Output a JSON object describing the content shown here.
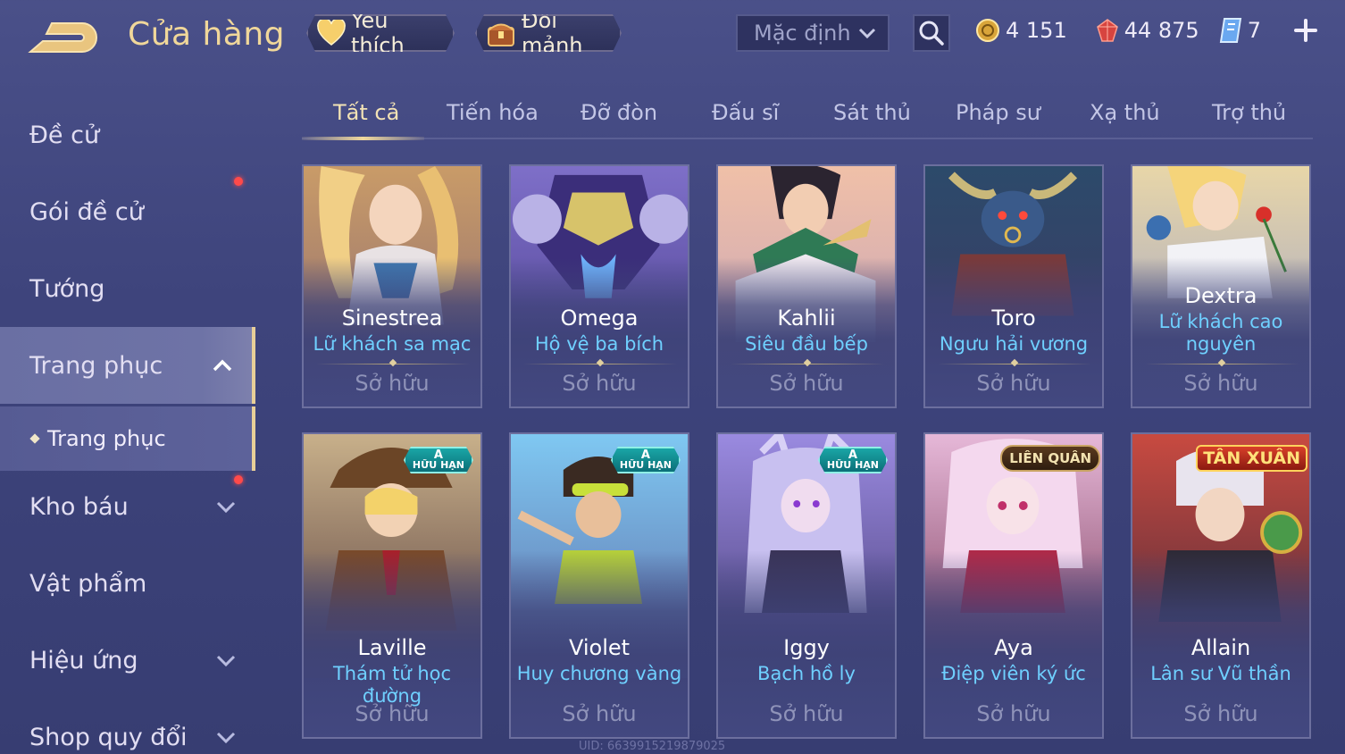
{
  "header": {
    "title": "Cửa hàng",
    "favorites_label": "Yêu thích",
    "shard_label": "Đổi mảnh",
    "sort_selected": "Mặc định",
    "currencies": {
      "gold": "4 151",
      "gem": "44 875",
      "ticket": "7"
    }
  },
  "sidebar": {
    "items": [
      {
        "label": "Đề cử"
      },
      {
        "label": "Gói đề cử"
      },
      {
        "label": "Tướng"
      },
      {
        "label": "Trang phục"
      },
      {
        "label": "Kho báu"
      },
      {
        "label": "Vật phẩm"
      },
      {
        "label": "Hiệu ứng"
      },
      {
        "label": "Shop quy đổi"
      }
    ],
    "sub_item": "Trang phục"
  },
  "tabs": [
    "Tất cả",
    "Tiến hóa",
    "Đỡ đòn",
    "Đấu sĩ",
    "Sát thủ",
    "Pháp sư",
    "Xạ thủ",
    "Trợ thủ"
  ],
  "cards": [
    {
      "hero": "Sinestrea",
      "skin": "Lữ khách sa mạc",
      "status": "Sở hữu"
    },
    {
      "hero": "Omega",
      "skin": "Hộ vệ ba bích",
      "status": "Sở hữu"
    },
    {
      "hero": "Kahlii",
      "skin": "Siêu đầu bếp",
      "status": "Sở hữu"
    },
    {
      "hero": "Toro",
      "skin": "Ngưu hải vương",
      "status": "Sở hữu"
    },
    {
      "hero": "Dextra",
      "skin": "Lữ khách cao nguyên",
      "status": "Sở hữu"
    },
    {
      "hero": "Laville",
      "skin": "Thám tử học đường",
      "status": "Sở hữu",
      "badge_top": "A",
      "badge_bottom": "HỮU HẠN"
    },
    {
      "hero": "Violet",
      "skin": "Huy chương vàng",
      "status": "Sở hữu",
      "badge_top": "A",
      "badge_bottom": "HỮU HẠN"
    },
    {
      "hero": "Iggy",
      "skin": "Bạch hồ ly",
      "status": "Sở hữu",
      "badge_top": "A",
      "badge_bottom": "HỮU HẠN"
    },
    {
      "hero": "Aya",
      "skin": "Điệp viên ký ức",
      "status": "Sở hữu",
      "badge_text": "LIÊN QUÂN"
    },
    {
      "hero": "Allain",
      "skin": "Lân sư Vũ thần",
      "status": "Sở hữu",
      "badge_text": "TÂN XUÂN"
    }
  ],
  "footer": {
    "uid": "UID: 6639915219879025"
  },
  "colors": {
    "accent_gold": "#f0d79a",
    "skin_name": "#6fd0ff",
    "badge_teal": "#1aa6a6",
    "notification": "#ff4a4a"
  },
  "icons": {
    "back": "back-arrow-icon",
    "favorites": "heart-icon",
    "shard": "treasure-chest-icon",
    "search": "search-icon",
    "gold": "gold-coin-icon",
    "gem": "ruby-gem-icon",
    "ticket": "ticket-icon",
    "plus": "plus-icon"
  }
}
